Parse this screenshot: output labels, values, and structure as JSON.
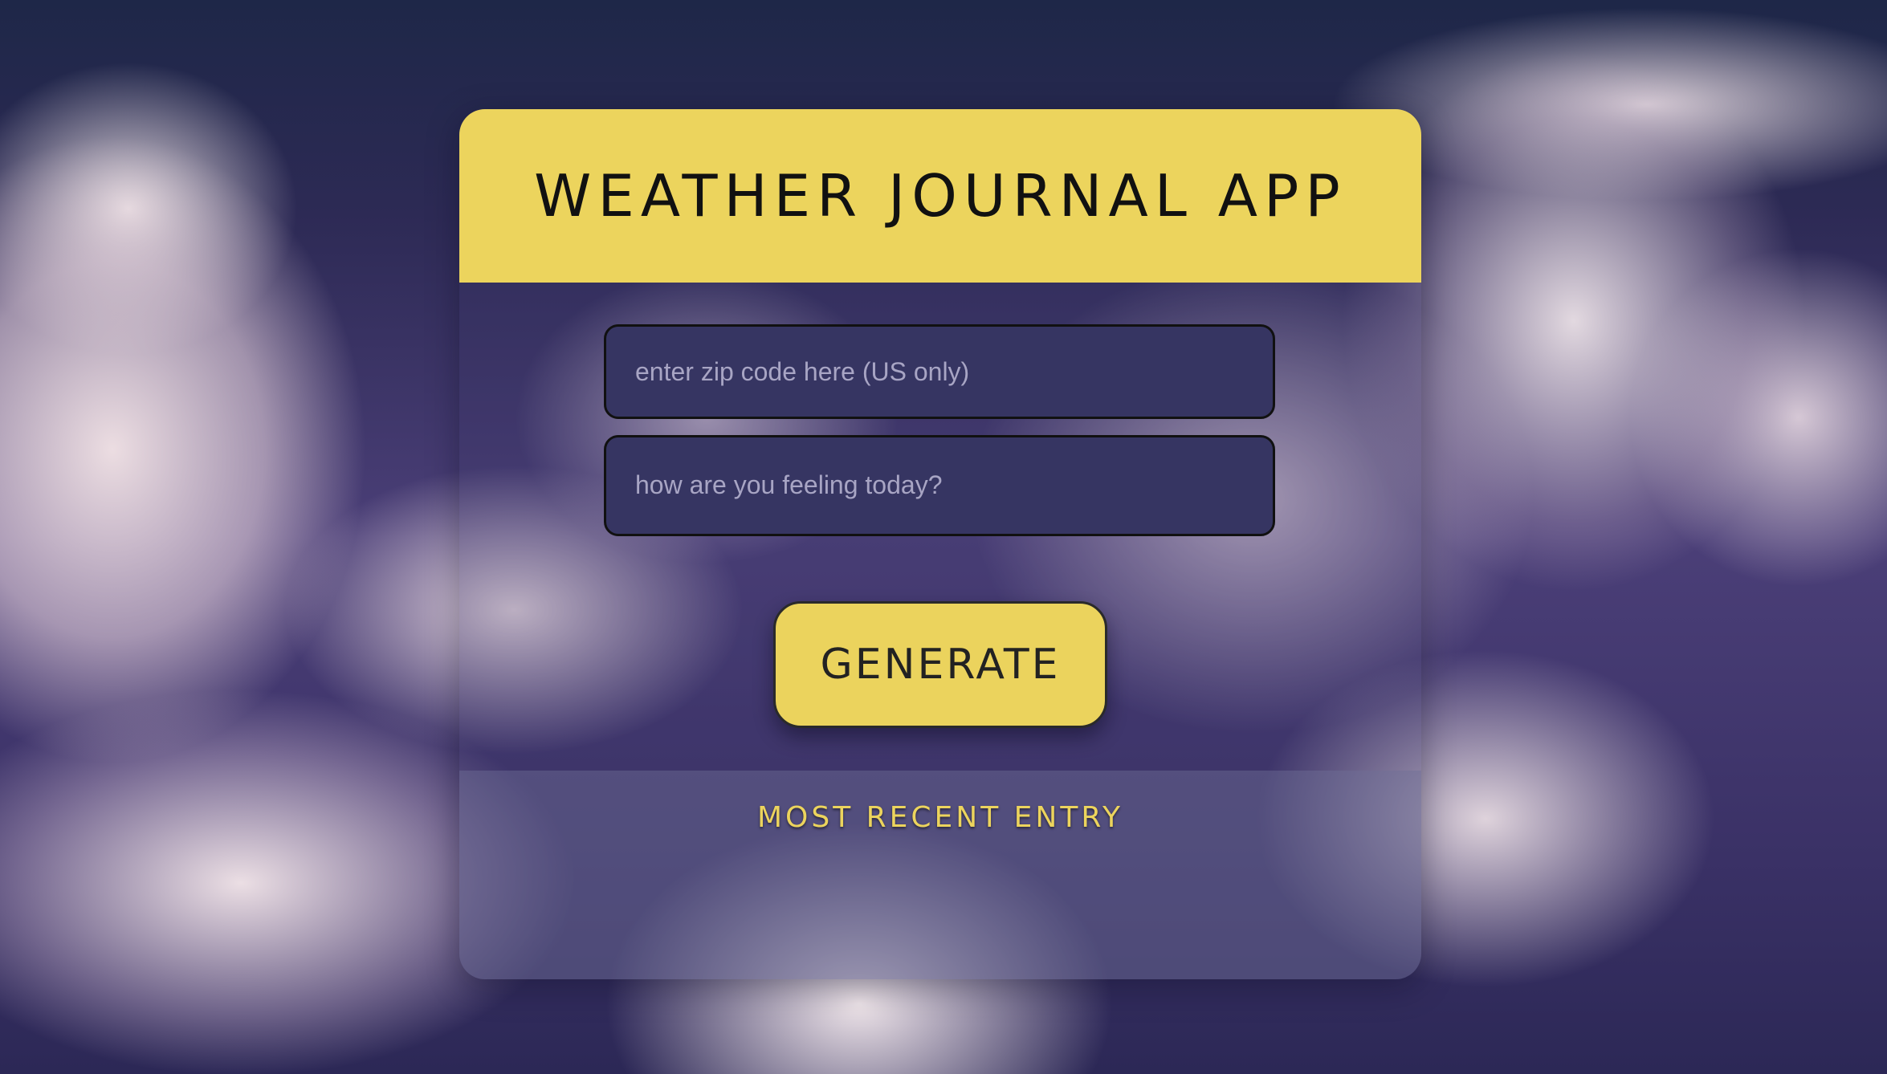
{
  "header": {
    "title": "WEATHER JOURNAL APP"
  },
  "form": {
    "zip_placeholder": "enter zip code here (US only)",
    "zip_value": "",
    "feelings_placeholder": "how are you feeling today?",
    "feelings_value": "",
    "generate_label": "GENERATE"
  },
  "entry": {
    "title": "MOST RECENT ENTRY"
  },
  "colors": {
    "accent_yellow": "#ecd45d",
    "input_bg": "#363562",
    "text_dark": "#111111"
  }
}
